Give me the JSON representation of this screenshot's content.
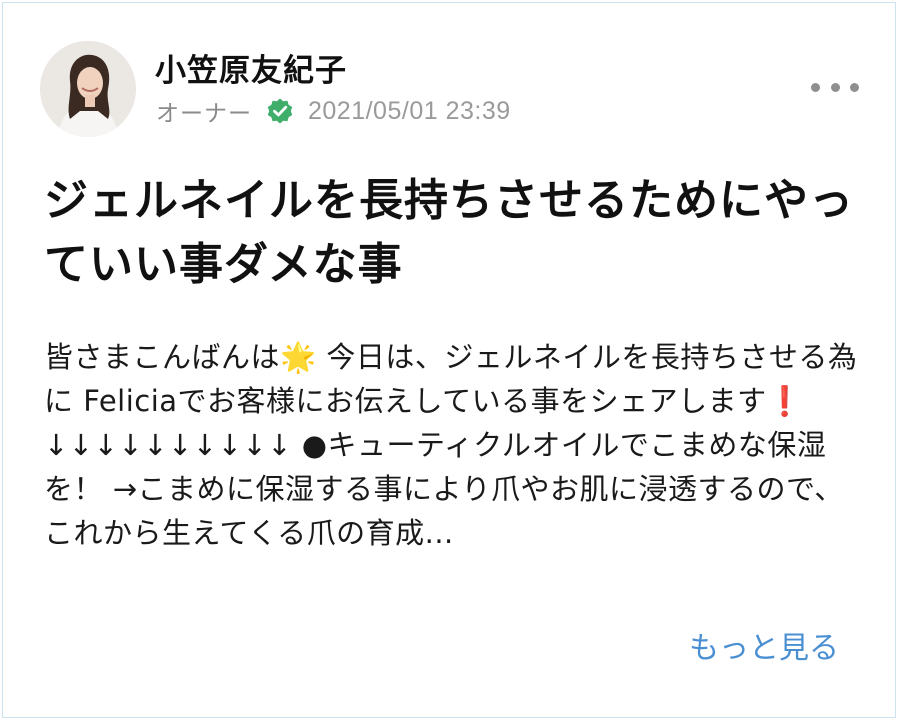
{
  "post": {
    "author": {
      "name": "小笠原友紀子",
      "role": "オーナー",
      "avatar_icon": "avatar-photo",
      "verified_icon": "verified-check-icon"
    },
    "timestamp": "2021/05/01 23:39",
    "more_menu_icon": "ellipsis-icon",
    "title": "ジェルネイルを長持ちさせるためにやっていい事ダメな事",
    "body_text": "皆さまこんばんは🌟 今日は、ジェルネイルを長持ちさせる為に Feliciaでお客様にお伝えしている事をシェアします❗️ ↓↓↓↓↓↓↓↓↓↓ ●キューティクルオイルでこまめな保湿を！ →こまめに保湿する事により爪やお肌に浸透するので、これから生えてくる爪の育成...",
    "see_more_label": "もっと見る"
  },
  "colors": {
    "link": "#4b8fd3",
    "verified_badge": "#3fae6a",
    "meta_text": "#8a8a8a",
    "card_border": "#cfe3ee"
  }
}
